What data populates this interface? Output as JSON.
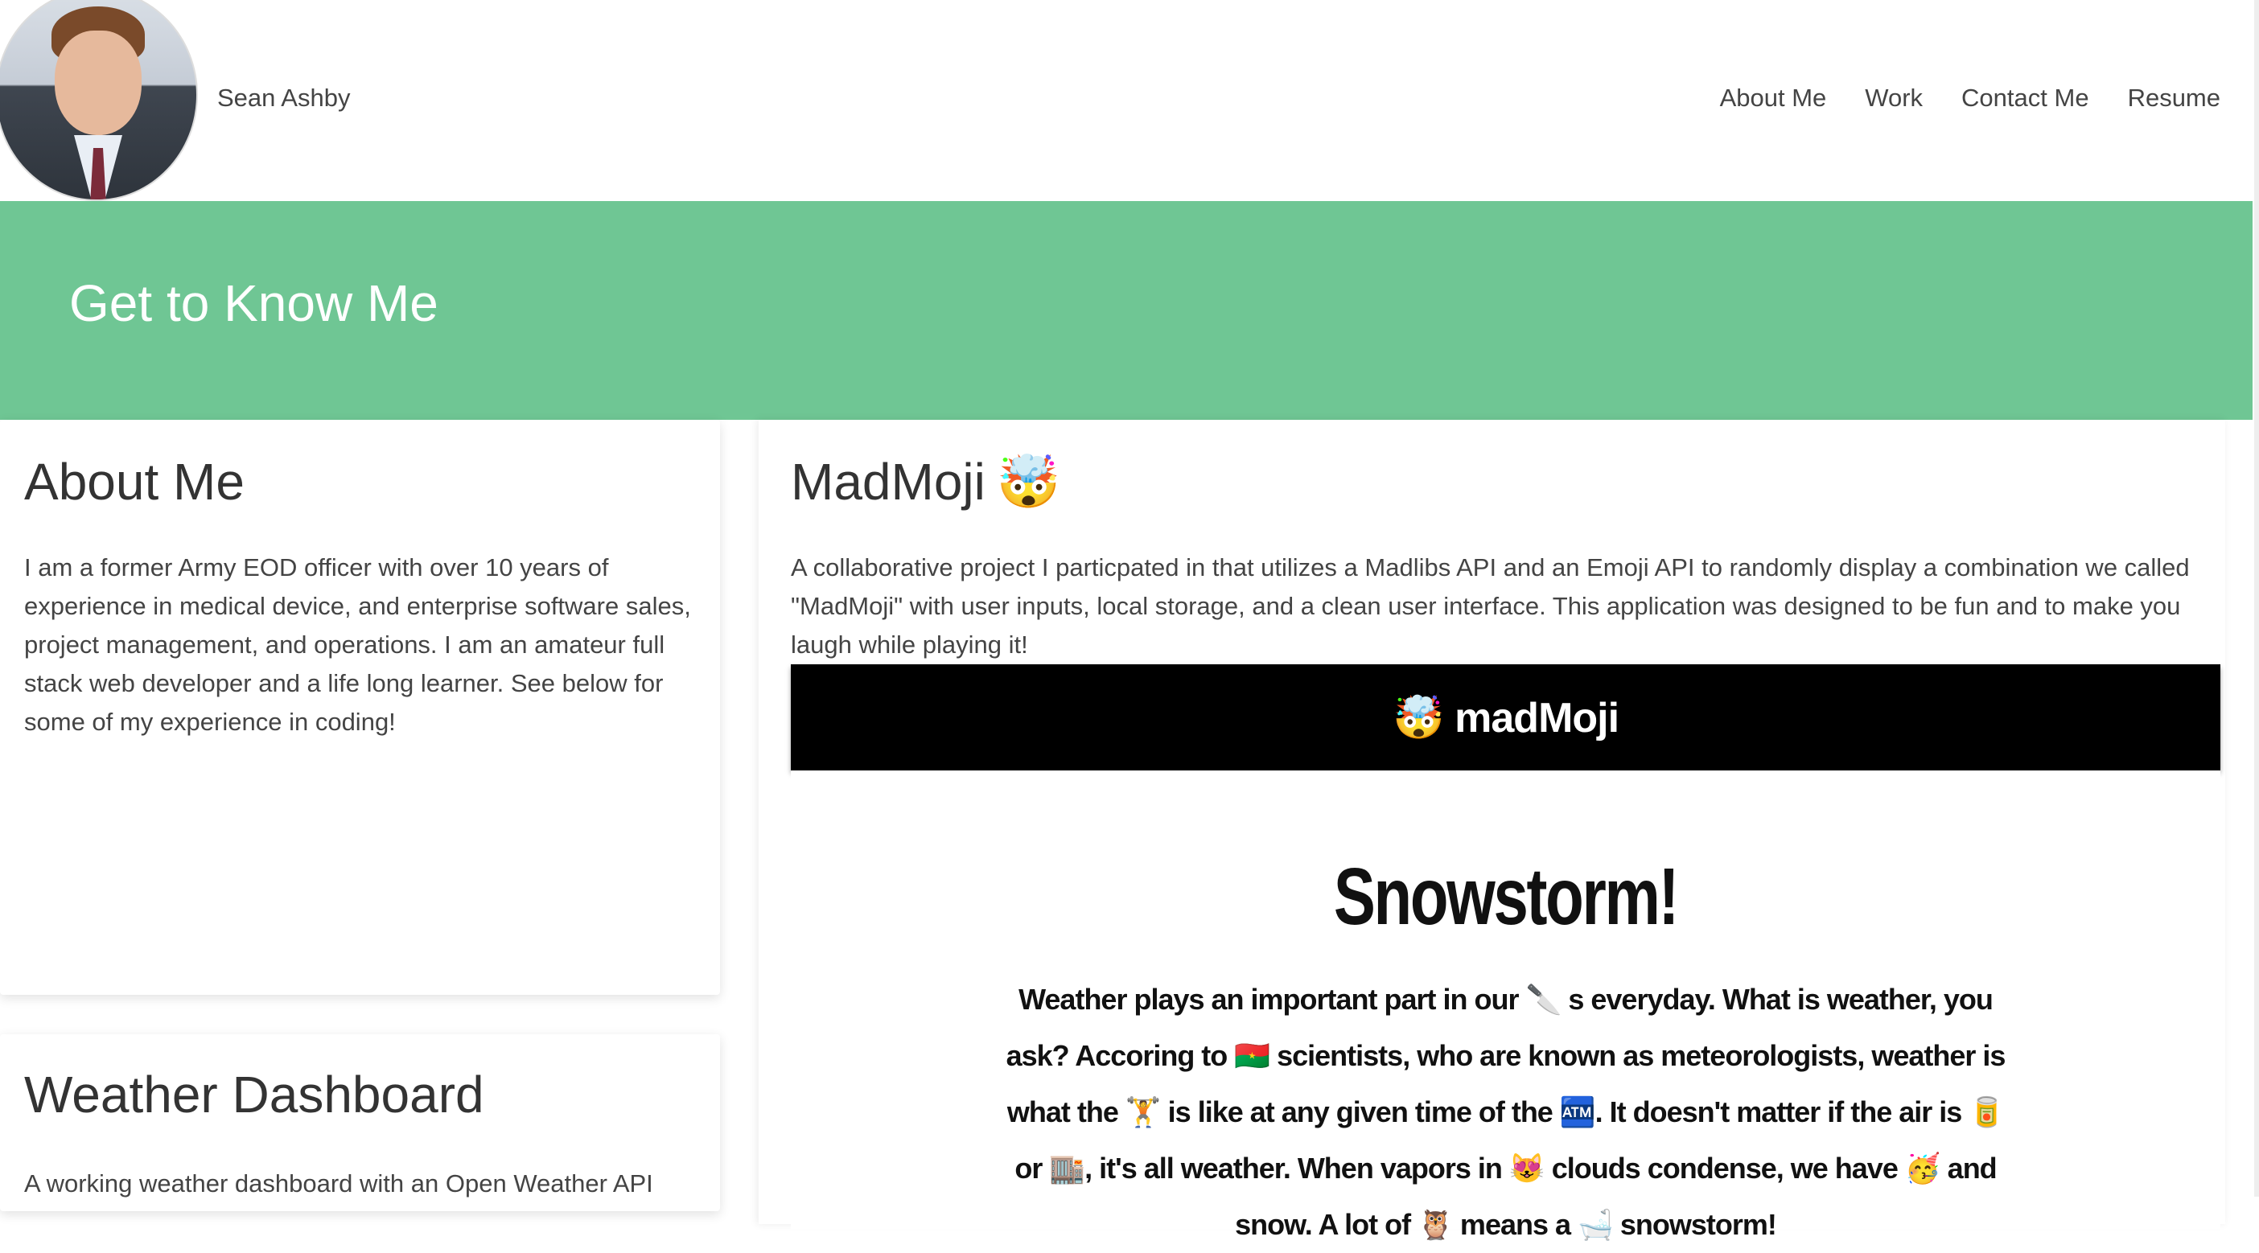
{
  "header": {
    "name": "Sean Ashby",
    "nav": [
      "About Me",
      "Work",
      "Contact Me",
      "Resume"
    ]
  },
  "hero": {
    "title": "Get to Know Me"
  },
  "about": {
    "title": "About Me",
    "text": "I am a former Army EOD officer with over 10 years of experience in medical device, and enterprise software sales, project management, and operations. I am an amateur full stack web developer and a life long learner. See below for some of my experience in coding!"
  },
  "weather": {
    "title": "Weather Dashboard",
    "text": "A working weather dashboard with an Open Weather API"
  },
  "madmoji": {
    "title": "MadMoji",
    "title_emoji": "🤯",
    "text": "A collaborative project I particpated in that utilizes a Madlibs API and an Emoji API to randomly display a combination we called \"MadMoji\" with user inputs, local storage, and a clean user interface. This application was designed to be fun and to make you laugh while playing it!",
    "app_logo": "🤯 madMoji",
    "story_title": "Snowstorm!",
    "story_text": "Weather plays an important part in our 🔪 s everyday. What is weather, you ask? Accoring to 🇧🇫 scientists, who are known as meteorologists, weather is what the 🏋 is like at any given time of the 🏧. It doesn't matter if the air is 🥫 or 🏬, it's all weather. When vapors in 😻 clouds condense, we have 🥳 and snow. A lot of 🦉 means a 🛁 snowstorm!"
  }
}
